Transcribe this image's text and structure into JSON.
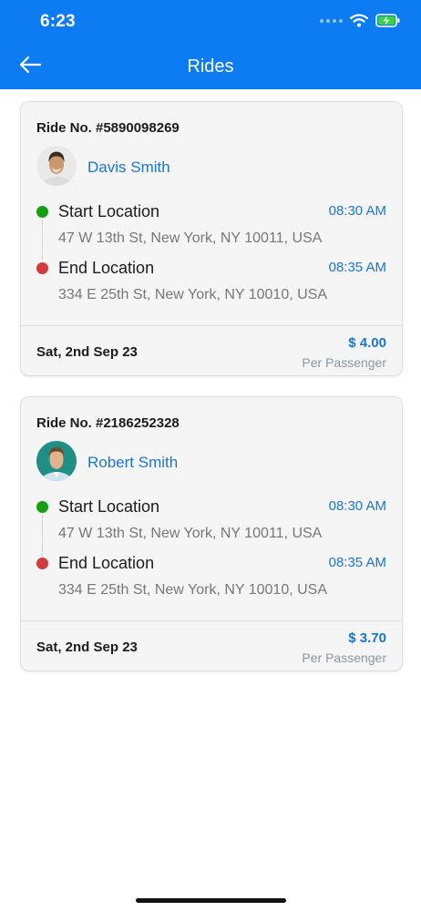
{
  "status": {
    "time": "6:23"
  },
  "header": {
    "title": "Rides"
  },
  "rides": [
    {
      "ride_no": "Ride No. #5890098269",
      "driver": "Davis Smith",
      "start_label": "Start Location",
      "start_time": "08:30 AM",
      "start_addr": "47 W 13th St, New York, NY 10011, USA",
      "end_label": "End Location",
      "end_time": "08:35 AM",
      "end_addr": "334 E 25th St, New York, NY 10010, USA",
      "date": "Sat, 2nd Sep 23",
      "price": "$ 4.00",
      "per": "Per Passenger"
    },
    {
      "ride_no": "Ride No. #2186252328",
      "driver": "Robert Smith",
      "start_label": "Start Location",
      "start_time": "08:30 AM",
      "start_addr": "47 W 13th St, New York, NY 10011, USA",
      "end_label": "End Location",
      "end_time": "08:35 AM",
      "end_addr": "334 E 25th St, New York, NY 10010, USA",
      "date": "Sat, 2nd Sep 23",
      "price": "$ 3.70",
      "per": "Per Passenger"
    }
  ],
  "colors": {
    "primary": "#0d7cf2",
    "accent_text": "#1976d2",
    "start_dot": "#12a012",
    "end_dot": "#d23c3c"
  },
  "icons": {
    "back": "arrow-left-icon",
    "wifi": "wifi-icon",
    "battery": "battery-charging-icon"
  }
}
